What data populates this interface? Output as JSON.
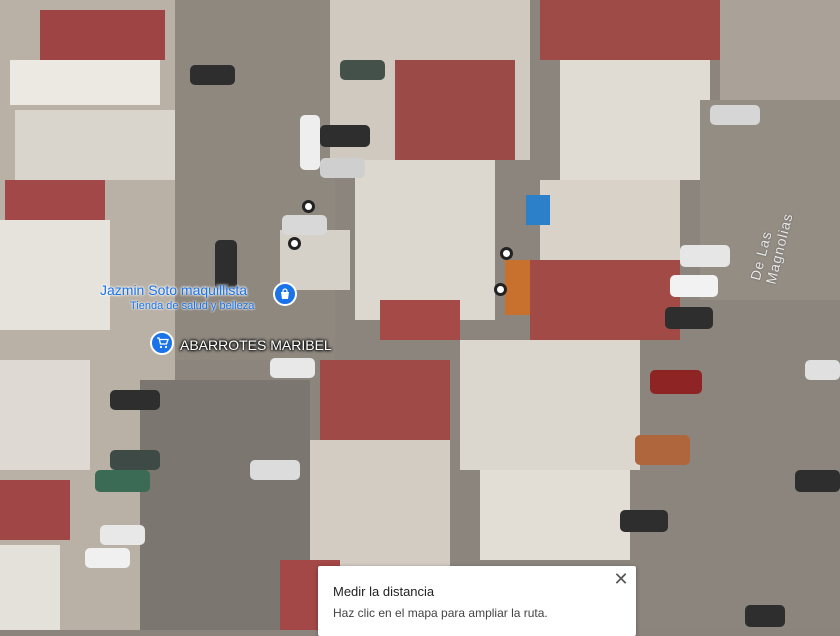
{
  "map": {
    "type": "satellite",
    "street_label": "De Las Magnolias"
  },
  "pois": [
    {
      "name": "Jazmin Soto maquillista",
      "category": "Tienda de salud y belleza",
      "icon": "shopping-bag-icon",
      "color": "#1a73e8"
    },
    {
      "name": "ABARROTES MARIBEL",
      "icon": "shopping-cart-icon",
      "color": "#1a73e8"
    }
  ],
  "measure_panel": {
    "title": "Medir la distancia",
    "instruction": "Haz clic en el mapa para ampliar la ruta.",
    "close_icon": "close-icon"
  }
}
